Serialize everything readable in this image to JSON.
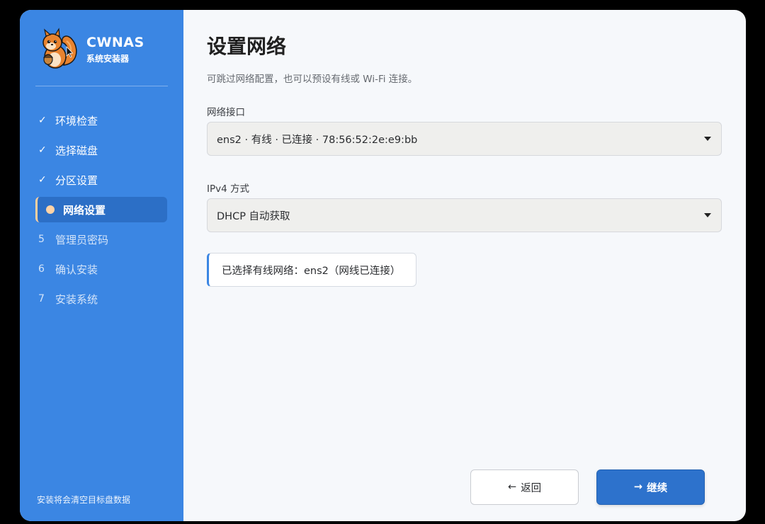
{
  "sidebar": {
    "brand_name": "CWNAS",
    "brand_sub": "系统安装器",
    "logo_icon": "squirrel-icon",
    "steps": [
      {
        "mark": "✓",
        "label": "环境检查",
        "state": "done"
      },
      {
        "mark": "✓",
        "label": "选择磁盘",
        "state": "done"
      },
      {
        "mark": "✓",
        "label": "分区设置",
        "state": "done"
      },
      {
        "mark": "",
        "label": "网络设置",
        "state": "active"
      },
      {
        "mark": "5",
        "label": "管理员密码",
        "state": "pending"
      },
      {
        "mark": "6",
        "label": "确认安装",
        "state": "pending"
      },
      {
        "mark": "7",
        "label": "安装系统",
        "state": "pending"
      }
    ],
    "footer": "安装将会清空目标盘数据"
  },
  "main": {
    "title": "设置网络",
    "description": "可跳过网络配置，也可以预设有线或 Wi-Fi 连接。",
    "interface_label": "网络接口",
    "interface_value": "ens2 · 有线 · 已连接 · 78:56:52:2e:e9:bb",
    "ipv4_label": "IPv4 方式",
    "ipv4_value": "DHCP 自动获取",
    "info": "已选择有线网络：ens2（网线已连接）"
  },
  "buttons": {
    "back_arrow": "←",
    "back_label": "返回",
    "next_arrow": "→",
    "next_label": "继续"
  },
  "colors": {
    "sidebar": "#3b86e3",
    "active_step": "#2c6fc6",
    "active_dot": "#ffd3a6",
    "primary_button": "#2d72cc"
  }
}
